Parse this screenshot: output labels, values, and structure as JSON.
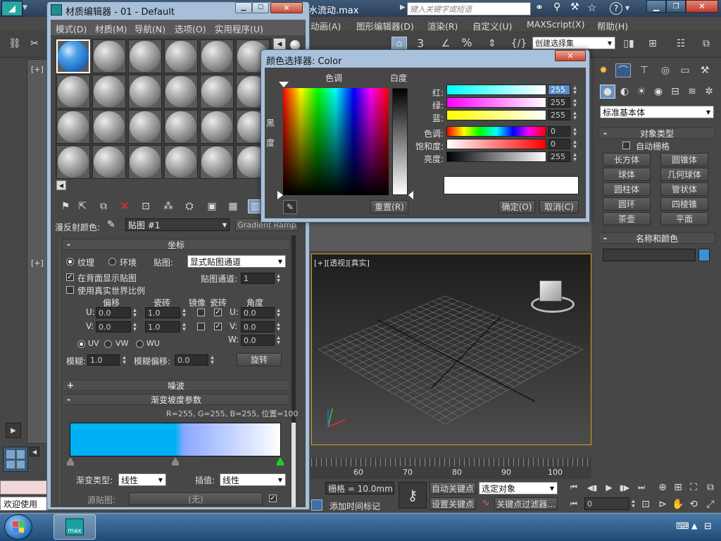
{
  "app": {
    "file_title": "水流动.max",
    "search_placeholder": "键入关键字或短语",
    "menu": [
      "动画(A)",
      "图形编辑器(D)",
      "渲染(R)",
      "自定义(U)",
      "MAXScript(X)",
      "帮助(H)"
    ],
    "selection_set": "创建选择集",
    "toolbar_number": "3"
  },
  "material_editor": {
    "title": "材质编辑器 - 01 - Default",
    "menu": [
      "模式(D)",
      "材质(M)",
      "导航(N)",
      "选项(O)",
      "实用程序(U)"
    ],
    "diffuse_label": "漫反射颜色:",
    "map_name": "贴图 #1",
    "map_type": "Gradient Ramp",
    "coordinates": {
      "header": "坐标",
      "texture": "纹理",
      "environ": "环境",
      "mapping_label": "贴图:",
      "mapping_value": "显式贴图通道",
      "show_map_back": "在背面显示贴图",
      "real_world": "使用真实世界比例",
      "channel_label": "贴图通道:",
      "channel_value": "1",
      "col_offset": "偏移",
      "col_tiling": "瓷砖",
      "col_mirror": "镜像",
      "col_tile": "瓷砖",
      "col_angle": "角度",
      "u_label": "U:",
      "v_label": "V:",
      "w_label": "W:",
      "u_offset": "0.0",
      "v_offset": "0.0",
      "u_tiling": "1.0",
      "v_tiling": "1.0",
      "u_angle": "0.0",
      "v_angle": "0.0",
      "w_angle": "0.0",
      "uv": "UV",
      "vw": "VW",
      "wu": "WU",
      "blur_label": "模糊:",
      "blur_value": "1.0",
      "blur_offset_label": "模糊偏移:",
      "blur_offset_value": "0.0",
      "rotate": "旋转"
    },
    "noise_header": "噪波",
    "gradient": {
      "header": "渐变坡度参数",
      "info": "R=255, G=255, B=255, 位置=100",
      "type_label": "渐变类型:",
      "type_value": "线性",
      "interp_label": "插值:",
      "interp_value": "线性",
      "source_label": "源贴图:",
      "source_value": "(无)"
    },
    "status_welcome": "欢迎使用"
  },
  "color_picker": {
    "title": "颜色选择器: Color",
    "hue_label": "色调",
    "whiteness_label": "白度",
    "black_label_1": "黑",
    "black_label_2": "度",
    "reset": "重置(R)",
    "ok": "确定(O)",
    "cancel": "取消(C)",
    "red_label": "红:",
    "green_label": "绿:",
    "blue_label": "蓝:",
    "hue2_label": "色调:",
    "sat_label": "饱和度:",
    "val_label": "亮度:",
    "red": "255",
    "green": "255",
    "blue": "255",
    "hue": "0",
    "sat": "0",
    "value": "255",
    "preview_color": "#ffffff"
  },
  "command_panel": {
    "category": "标准基本体",
    "object_type_header": "对象类型",
    "auto_grid": "自动栅格",
    "buttons": [
      "长方体",
      "圆锥体",
      "球体",
      "几何球体",
      "圆柱体",
      "管状体",
      "圆环",
      "四棱锥",
      "茶壶",
      "平面"
    ],
    "name_color_header": "名称和颜色"
  },
  "viewport": {
    "label": "[+][透视][真实]",
    "ruler": [
      "60",
      "70",
      "80",
      "90",
      "100"
    ],
    "left_labels": [
      "[+]",
      "[+]"
    ]
  },
  "bottom": {
    "grid": "栅格 = 10.0mm",
    "add_time_tag": "添加时间标记",
    "auto_key": "自动关键点",
    "set_key": "设置关键点",
    "selected_object": "选定对象",
    "key_filters": "关键点过滤器...",
    "frame": "0"
  },
  "taskbar": {
    "max_label": "max"
  }
}
